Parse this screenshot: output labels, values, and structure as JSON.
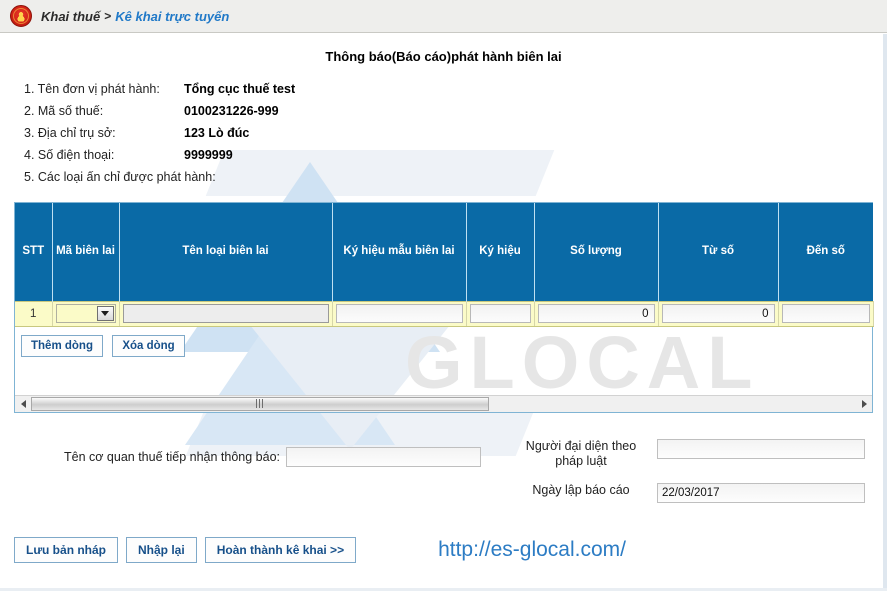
{
  "breadcrumb": {
    "emblem_icon": "vietnam-emblem-icon",
    "root": "Khai thuế",
    "separator": ">",
    "current": "Kê khai trực tuyến"
  },
  "document": {
    "title": "Thông báo(Báo cáo)phát hành biên lai",
    "info_rows": [
      {
        "label": "1. Tên đơn vị phát hành:",
        "value": "Tổng cục thuế test"
      },
      {
        "label": "2. Mã số thuế:",
        "value": "0100231226-999"
      },
      {
        "label": "3. Địa chỉ trụ sở:",
        "value": "123 Lò đúc"
      },
      {
        "label": "4. Số điện thoại:",
        "value": "9999999"
      }
    ],
    "section_5_label": "5. Các loại ấn chỉ được phát hành:"
  },
  "grid": {
    "columns": [
      "STT",
      "Mã biên lai",
      "Tên loại biên lai",
      "Ký hiệu mẫu biên lai",
      "Ký hiệu",
      "Số lượng",
      "Từ số",
      "Đến số"
    ],
    "rows": [
      {
        "stt": "1",
        "ma_bien_lai": "",
        "ten_loai_bien_lai": "",
        "ky_hieu_mau_bien_lai": "",
        "ky_hieu": "",
        "so_luong": "0",
        "tu_so": "0",
        "den_so": ""
      }
    ],
    "row_buttons": [
      {
        "label": "Thêm dòng",
        "name": "add-row-button"
      },
      {
        "label": "Xóa dòng",
        "name": "delete-row-button"
      }
    ],
    "header_color": "#0a6aa6",
    "row_color": "#fbfbc8",
    "scroll": {
      "thumb_pct": "55.5",
      "left_arrow_icon": "chevron-left-icon",
      "right_arrow_icon": "chevron-right-icon"
    }
  },
  "bottom_form": {
    "receiving_agency_label": "Tên cơ quan thuế tiếp nhận thông báo:",
    "receiving_agency_value": "",
    "legal_representative_label": "Người đại diện theo pháp luật",
    "legal_representative_value": "",
    "report_date_label": "Ngày lập báo cáo",
    "report_date_value": "22/03/2017"
  },
  "footer": {
    "buttons": [
      {
        "label": "Lưu bản nháp",
        "name": "save-draft-button"
      },
      {
        "label": "Nhập lại",
        "name": "reset-button"
      },
      {
        "label": "Hoàn thành kê khai >>",
        "name": "complete-declaration-button"
      }
    ],
    "watermark_url": "http://es-glocal.com/",
    "watermark_url_color": "#2c7cc4"
  },
  "watermarks": {
    "glocal_text": "GLOCAL",
    "glocal_color": "#e6e6e6"
  }
}
